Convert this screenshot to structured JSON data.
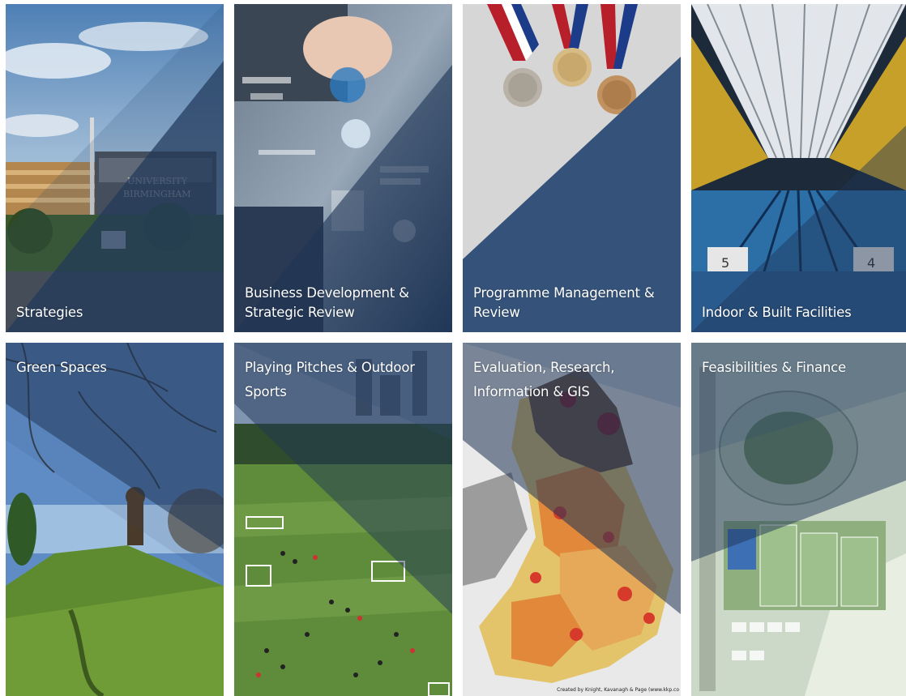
{
  "colors": {
    "overlay_blue": "#2f4c72",
    "overlay_dark": "#1f3556",
    "background": "#ffffff",
    "caption_text": "#ffffff"
  },
  "tiles": [
    {
      "id": "strategies",
      "lines": [
        "Strategies"
      ],
      "image_icon": "stadium-building-photo"
    },
    {
      "id": "business-development",
      "lines": [
        "Business Development &",
        "Strategic Review"
      ],
      "image_icon": "business-diagram-photo"
    },
    {
      "id": "programme-management",
      "lines": [
        "Programme Management &",
        "Review"
      ],
      "image_icon": "medals-photo"
    },
    {
      "id": "indoor-facilities",
      "lines": [
        "Indoor & Built Facilities"
      ],
      "image_icon": "swimming-pool-photo"
    },
    {
      "id": "green-spaces",
      "lines": [
        "Green Spaces"
      ],
      "image_icon": "park-trees-photo"
    },
    {
      "id": "playing-pitches",
      "lines": [
        "Playing Pitches & Outdoor",
        "Sports"
      ],
      "image_icon": "football-pitches-photo"
    },
    {
      "id": "evaluation-research",
      "lines": [
        "Evaluation, Research,",
        "Information & GIS"
      ],
      "image_icon": "england-map-photo",
      "credit": "Created by Knight, Kavanagh & Page (www.kkp.co"
    },
    {
      "id": "feasibilities-finance",
      "lines": [
        "Feasibilities & Finance"
      ],
      "image_icon": "site-plan-photo"
    }
  ]
}
